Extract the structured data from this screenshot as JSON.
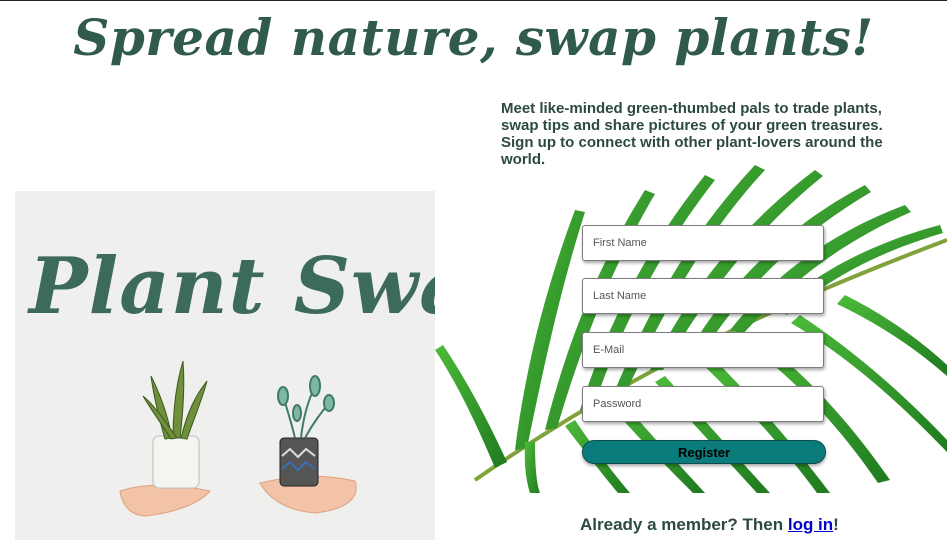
{
  "header": {
    "title": "Spread nature, swap plants!"
  },
  "intro": {
    "text": "Meet like-minded green-thumbed pals to trade plants, swap tips and share pictures of your green treasures. Sign up to connect with other plant-lovers around the world."
  },
  "hero": {
    "logo_text": "Plant Swap"
  },
  "form": {
    "first_name_placeholder": "First Name",
    "last_name_placeholder": "Last Name",
    "email_placeholder": "E-Mail",
    "password_placeholder": "Password",
    "register_label": "Register"
  },
  "footer": {
    "login_prefix": "Already a member? Then ",
    "login_link": "log in",
    "login_suffix": "!"
  },
  "colors": {
    "title": "#2f5a4c",
    "text": "#2c4a3e",
    "button": "#0c7b7b",
    "link": "#0000cc",
    "leaf": "#2f9a2a"
  },
  "icons": [
    "palm-leaf-illustration",
    "snake-plant-pot-illustration",
    "succulent-pot-illustration",
    "hands-illustration"
  ]
}
